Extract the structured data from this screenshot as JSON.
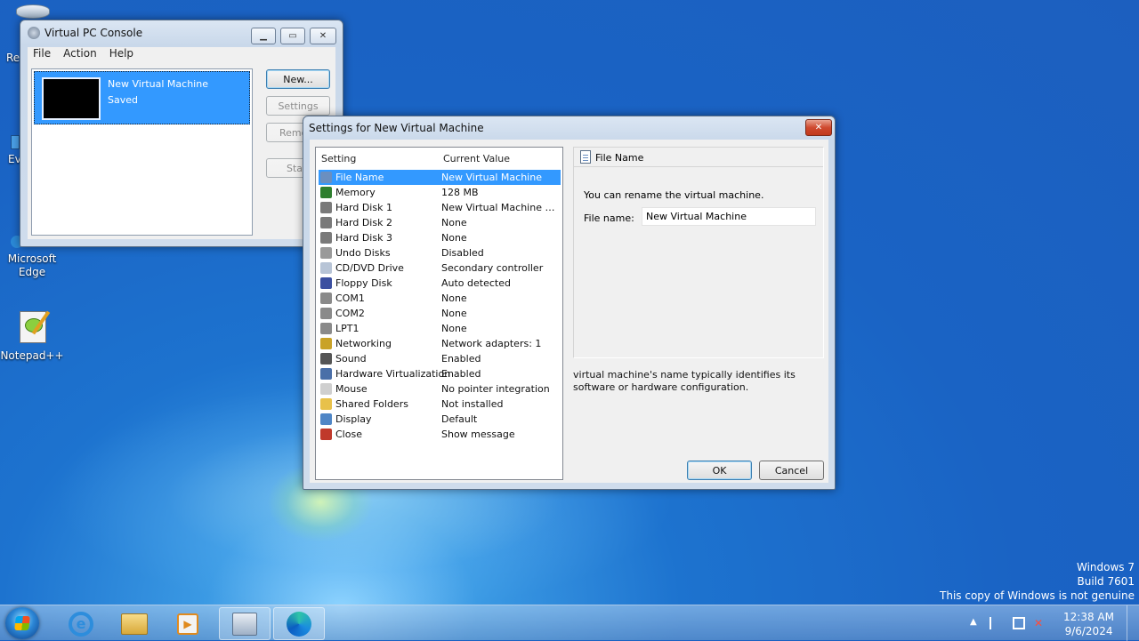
{
  "desktop": {
    "icons": [
      {
        "label": "Microsoft Edge"
      },
      {
        "label": "Notepad++"
      }
    ],
    "partial_labels": [
      "Re",
      "Ev"
    ]
  },
  "console": {
    "title": "Virtual PC Console",
    "menu": [
      "File",
      "Action",
      "Help"
    ],
    "vm": {
      "name": "New Virtual Machine",
      "status": "Saved"
    },
    "buttons": {
      "new": "New...",
      "settings": "Settings",
      "remove": "Remo",
      "start": "Star"
    }
  },
  "settings": {
    "title": "Settings for New Virtual Machine",
    "columns": {
      "setting": "Setting",
      "value": "Current Value"
    },
    "rows": [
      {
        "name": "File Name",
        "value": "New Virtual Machine",
        "icon": "file-icon",
        "color": "#6a8fc0"
      },
      {
        "name": "Memory",
        "value": "128 MB",
        "icon": "memory-icon",
        "color": "#2f7f2f"
      },
      {
        "name": "Hard Disk 1",
        "value": "New Virtual Machine Har...",
        "icon": "hard-disk-icon",
        "color": "#7a7a7a"
      },
      {
        "name": "Hard Disk 2",
        "value": "None",
        "icon": "hard-disk-icon",
        "color": "#7a7a7a"
      },
      {
        "name": "Hard Disk 3",
        "value": "None",
        "icon": "hard-disk-icon",
        "color": "#7a7a7a"
      },
      {
        "name": "Undo Disks",
        "value": "Disabled",
        "icon": "undo-disk-icon",
        "color": "#9a9a9a"
      },
      {
        "name": "CD/DVD Drive",
        "value": "Secondary controller",
        "icon": "cd-icon",
        "color": "#b7c4d6"
      },
      {
        "name": "Floppy Disk",
        "value": "Auto detected",
        "icon": "floppy-icon",
        "color": "#3b4fa0"
      },
      {
        "name": "COM1",
        "value": "None",
        "icon": "port-icon",
        "color": "#8a8a8a"
      },
      {
        "name": "COM2",
        "value": "None",
        "icon": "port-icon",
        "color": "#8a8a8a"
      },
      {
        "name": "LPT1",
        "value": "None",
        "icon": "port-icon",
        "color": "#8a8a8a"
      },
      {
        "name": "Networking",
        "value": "Network adapters: 1",
        "icon": "network-icon",
        "color": "#c9a227"
      },
      {
        "name": "Sound",
        "value": "Enabled",
        "icon": "sound-icon",
        "color": "#555555"
      },
      {
        "name": "Hardware Virtualization",
        "value": "Enabled",
        "icon": "chip-icon",
        "color": "#4a6fa8"
      },
      {
        "name": "Mouse",
        "value": "No pointer integration",
        "icon": "mouse-icon",
        "color": "#cfcfcf"
      },
      {
        "name": "Shared Folders",
        "value": "Not installed",
        "icon": "folder-icon",
        "color": "#e8c14a"
      },
      {
        "name": "Display",
        "value": "Default",
        "icon": "display-icon",
        "color": "#4f86c6"
      },
      {
        "name": "Close",
        "value": "Show message",
        "icon": "close-vm-icon",
        "color": "#c0392b"
      }
    ],
    "detail": {
      "heading": "File Name",
      "description": "You can rename the virtual machine.",
      "field_label": "File name:",
      "field_value": "New Virtual Machine",
      "hint": "virtual machine's name typically identifies its software or hardware configuration."
    },
    "buttons": {
      "ok": "OK",
      "cancel": "Cancel"
    }
  },
  "watermark": {
    "line1": "Windows 7",
    "line2": "Build 7601",
    "line3": "This copy of Windows is not genuine"
  },
  "taskbar": {
    "time": "12:38 AM",
    "date": "9/6/2024"
  }
}
